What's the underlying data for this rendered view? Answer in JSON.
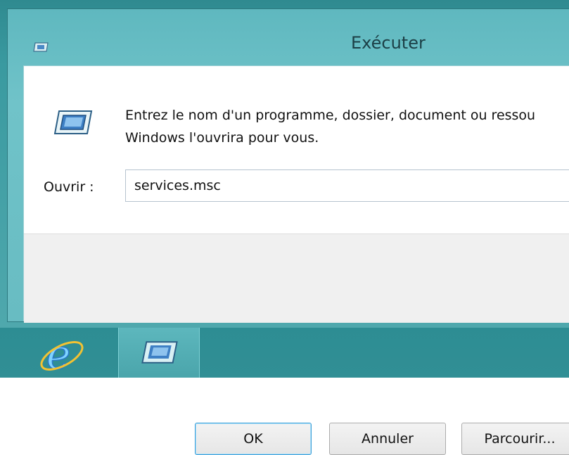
{
  "dialog": {
    "title": "Exécuter",
    "description_line1": "Entrez le nom d'un programme, dossier, document ou ressou",
    "description_line2": "Windows l'ouvrira pour vous.",
    "open_label": "Ouvrir :",
    "open_value": "services.msc",
    "ok_label": "OK",
    "cancel_label": "Annuler",
    "browse_label": "Parcourir..."
  },
  "taskbar": {
    "items": [
      {
        "icon": "internet-explorer-icon"
      },
      {
        "icon": "run-dialog-icon",
        "active": true
      }
    ]
  },
  "colors": {
    "frame": "#68bcc2",
    "taskbar": "#2d8d93",
    "ok_border": "#3c9fd8"
  }
}
